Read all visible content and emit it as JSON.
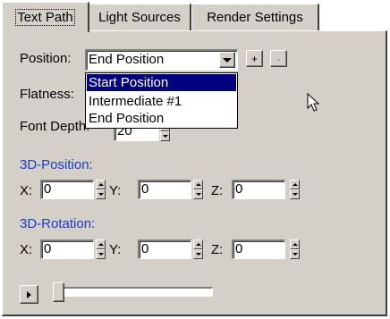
{
  "tabs": [
    {
      "label": "Text Path",
      "active": true
    },
    {
      "label": "Light Sources",
      "active": false
    },
    {
      "label": "Render Settings",
      "active": false
    }
  ],
  "position": {
    "label": "Position:",
    "value": "End Position",
    "add_label": "+",
    "remove_label": "-",
    "options": [
      "Start Position",
      "Intermediate #1",
      "End Position"
    ],
    "highlighted": "Start Position"
  },
  "flatness": {
    "label": "Flatness:"
  },
  "font_depth": {
    "label": "Font Depth:",
    "value": "20"
  },
  "position3d": {
    "heading": "3D-Position:",
    "x_label": "X:",
    "x": "0",
    "y_label": "Y:",
    "y": "0",
    "z_label": "Z:",
    "z": "0"
  },
  "rotation3d": {
    "heading": "3D-Rotation:",
    "x_label": "X:",
    "x": "0",
    "y_label": "Y:",
    "y": "0",
    "z_label": "Z:",
    "z": "0"
  },
  "animation": {
    "slider_value": 0
  },
  "colors": {
    "heading_blue": "#1a3ccc",
    "selection": "#000080",
    "face": "#d4d0c8"
  }
}
